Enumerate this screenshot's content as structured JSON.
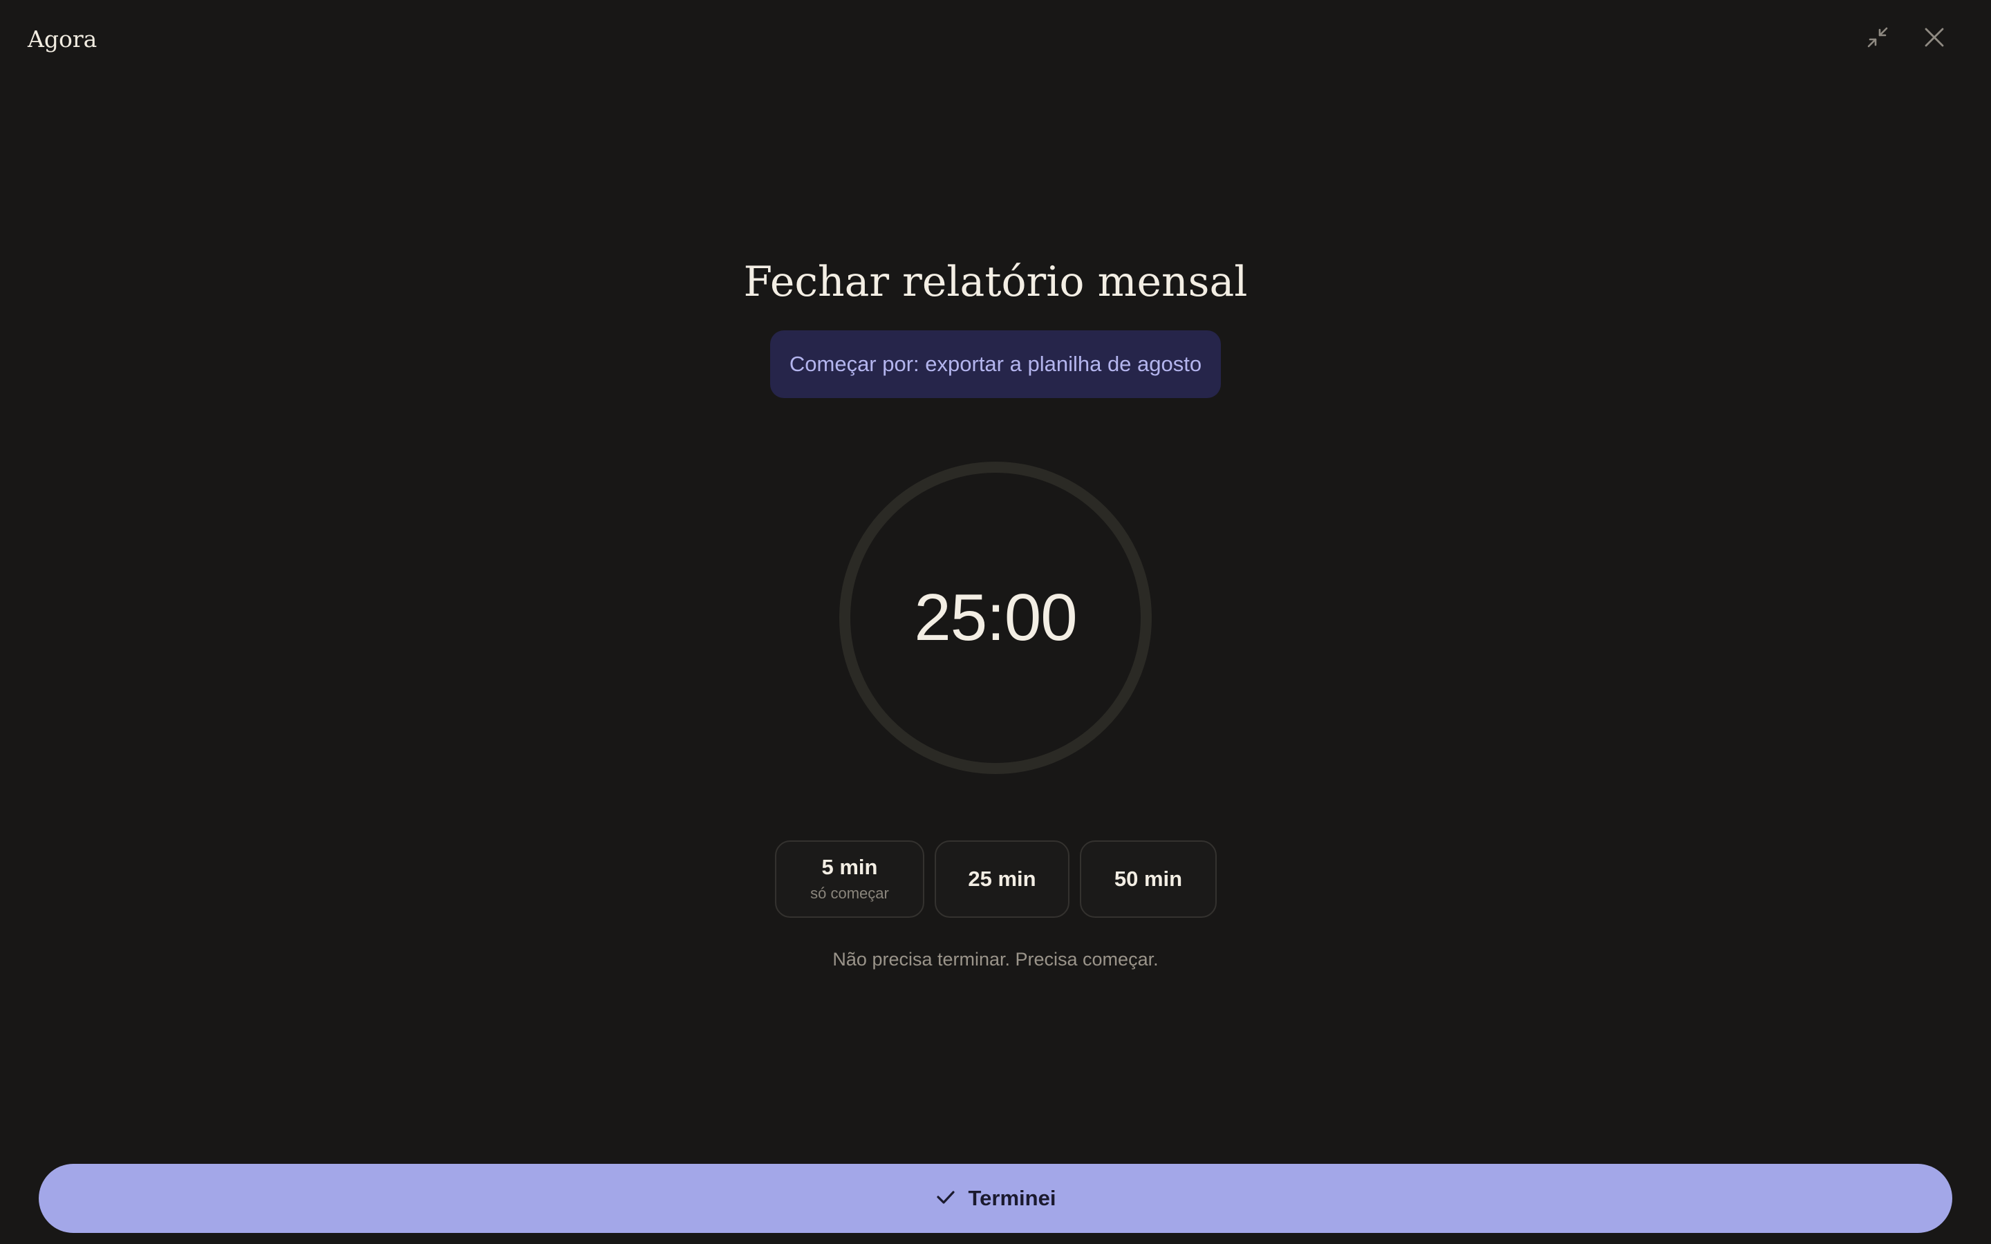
{
  "app": {
    "title": "Agora"
  },
  "window_controls": {
    "minimize_icon": "collapse-arrows-icon",
    "close_icon": "close-x-icon"
  },
  "task": {
    "title": "Fechar relatório mensal",
    "first_step": "Começar por: exportar a planilha de agosto"
  },
  "timer": {
    "display": "25:00",
    "progress": 0
  },
  "durations": [
    {
      "label": "5 min",
      "sublabel": "só começar"
    },
    {
      "label": "25 min",
      "sublabel": ""
    },
    {
      "label": "50 min",
      "sublabel": ""
    }
  ],
  "tagline": "Não precisa terminar. Precisa começar.",
  "done_button": {
    "label": "Terminei",
    "icon": "checkmark-icon"
  },
  "colors": {
    "background": "#181716",
    "text": "#f1ece1",
    "accent": "#a3a7e8",
    "first_step_bg": "#26254a",
    "first_step_text": "#b4b5ee",
    "ring": "#2b2a25",
    "muted": "#9a948a"
  }
}
